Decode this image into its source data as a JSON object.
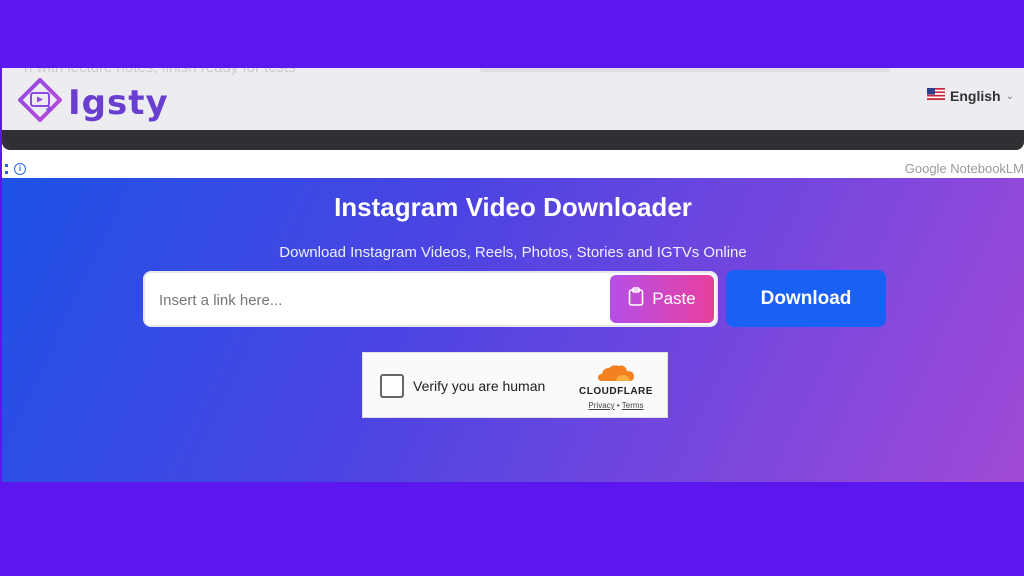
{
  "header": {
    "background_text": "h with lecture notes, finish ready for tests",
    "logo_text": "Igsty",
    "language_label": "English",
    "language_flag": "us-flag-icon"
  },
  "extension_bar": {
    "label": "Google NotebookLM"
  },
  "hero": {
    "title": "Instagram Video Downloader",
    "subtitle": "Download Instagram Videos, Reels, Photos, Stories and IGTVs Online"
  },
  "search": {
    "placeholder": "Insert a link here...",
    "value": "",
    "paste_label": "Paste",
    "download_label": "Download"
  },
  "captcha": {
    "label": "Verify you are human",
    "brand": "CLOUDFLARE",
    "privacy": "Privacy",
    "separator": "•",
    "terms": "Terms"
  },
  "colors": {
    "page_background": "#5b17ee",
    "download_button": "#1960f4",
    "paste_gradient_start": "#b54fe8",
    "paste_gradient_end": "#e83f9e",
    "logo": "#6a3fd0",
    "cloudflare_orange": "#f48120"
  }
}
